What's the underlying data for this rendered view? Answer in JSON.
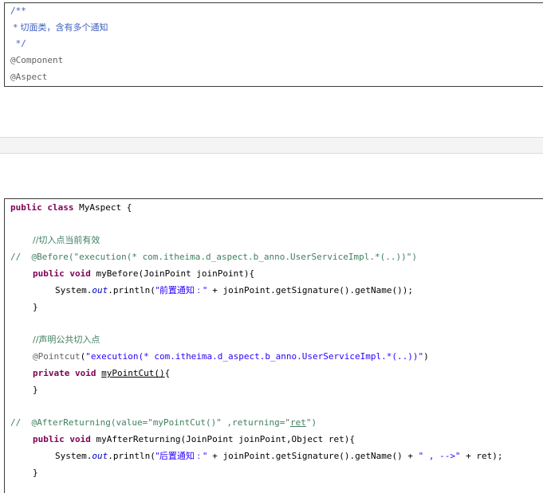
{
  "box1": {
    "lines": [
      "/**",
      " * 切面类，含有多个通知",
      " */",
      "@Component",
      "@Aspect"
    ]
  },
  "box2": {
    "l1_kw": "public class",
    "l1_rest": " MyAspect {",
    "l3": "//切入点当前有效",
    "l4": "//  @Before(\"execution(* com.itheima.d_aspect.b_anno.UserServiceImpl.*(..))\")",
    "l5_kw": "public void",
    "l5_rest": " myBefore(JoinPoint joinPoint){",
    "l6_a": "System.",
    "l6_out": "out",
    "l6_b": ".println(",
    "l6_str": "\"前置通知 : \"",
    "l6_c": " + joinPoint.getSignature().getName());",
    "l7": "}",
    "l9": "//声明公共切入点",
    "l10_ann": "@Pointcut",
    "l10_a": "(",
    "l10_str": "\"execution(* com.itheima.d_aspect.b_anno.UserServiceImpl.*(..))\"",
    "l10_b": ")",
    "l11_kw": "private void",
    "l11_sp": " ",
    "l11_name": "myPointCut()",
    "l11_rest": "{",
    "l12": "}",
    "l14_a": "//  @AfterReturning(value=\"myPointCut()\" ,returning=\"",
    "l14_ret": "ret",
    "l14_b": "\")",
    "l15_kw": "public void",
    "l15_rest": " myAfterReturning(JoinPoint joinPoint,Object ret){",
    "l16_a": "System.",
    "l16_out": "out",
    "l16_b": ".println(",
    "l16_str1": "\"后置通知 : \"",
    "l16_c": " + joinPoint.getSignature().getName() + ",
    "l16_str2": "\" , -->\"",
    "l16_d": " + ret);",
    "l17": "}"
  },
  "colors": {
    "keyword": "#7f0055",
    "comment": "#3f7f5f",
    "javadoc": "#3f5fbf",
    "string": "#2a00ff",
    "annotation": "#646464",
    "static_field": "#0000c0"
  }
}
